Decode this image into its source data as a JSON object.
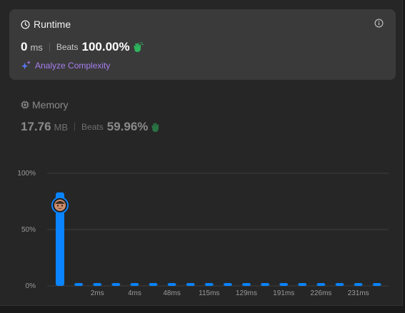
{
  "runtime": {
    "title": "Runtime",
    "value": "0",
    "unit": "ms",
    "beats_label": "Beats",
    "beats_value": "100.00%",
    "analyze_label": "Analyze Complexity"
  },
  "memory": {
    "title": "Memory",
    "value": "17.76",
    "unit": "MB",
    "beats_label": "Beats",
    "beats_value": "59.96%"
  },
  "colors": {
    "bar": "#0a84ff",
    "accent_purple": "#a77ff0",
    "clap_green": "#2db55d"
  },
  "chart_data": {
    "type": "bar",
    "y_tick_labels": [
      "100%",
      "50%",
      "0%"
    ],
    "ylim": [
      0,
      100
    ],
    "x_tick_labels": [
      "2ms",
      "4ms",
      "48ms",
      "115ms",
      "129ms",
      "191ms",
      "226ms",
      "231ms"
    ],
    "values": [
      83,
      1.5,
      1.5,
      1.5,
      1.5,
      1.5,
      1.5,
      1.5,
      1.5,
      1.5,
      1.5,
      1.5,
      1.5,
      1.5,
      1.5,
      1.5,
      1.5,
      1.5
    ],
    "highlight_index": 0,
    "grid": true
  }
}
